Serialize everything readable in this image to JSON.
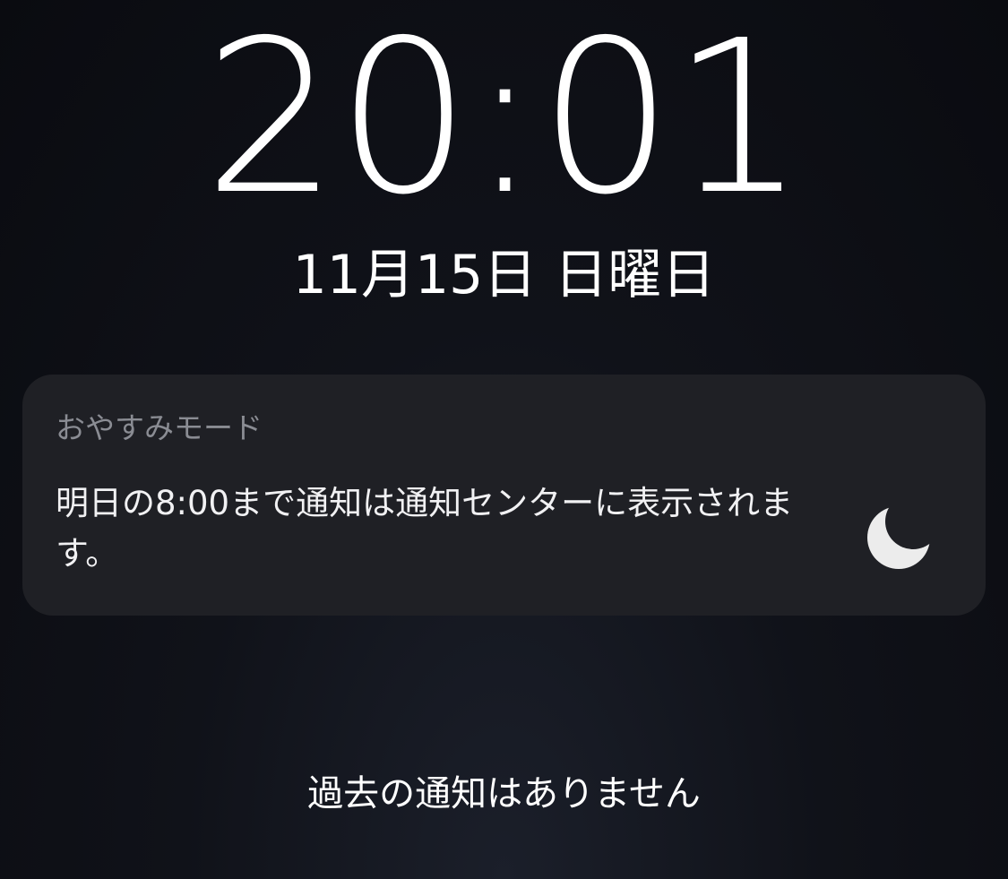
{
  "lock_screen": {
    "time": "20:01",
    "date": "11月15日 日曜日"
  },
  "focus_notification": {
    "title": "おやすみモード",
    "message": "明日の8:00まで通知は通知センターに表示されます。",
    "icon": "moon-icon"
  },
  "notification_center": {
    "empty_text": "過去の通知はありません"
  },
  "colors": {
    "background": "#0a0b10",
    "card": "#1f2025",
    "title_text": "#8a8c93",
    "primary_text": "#ffffff",
    "icon": "#ececec"
  }
}
